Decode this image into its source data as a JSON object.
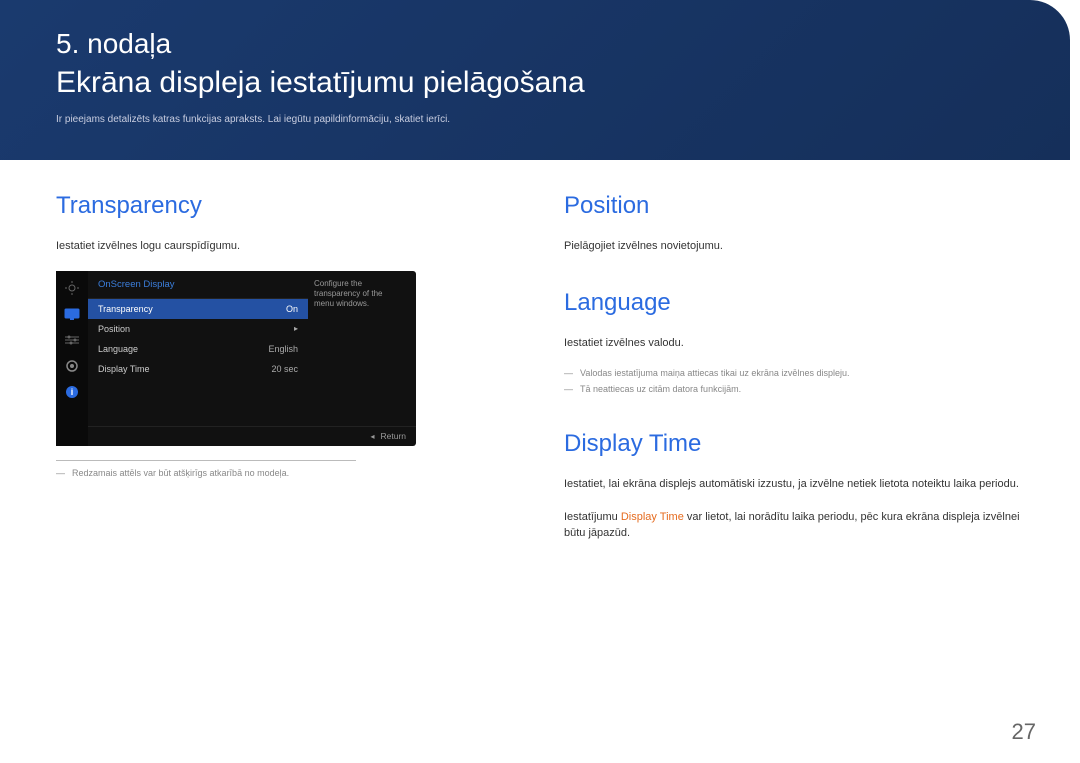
{
  "header": {
    "chapter": "5. nodaļa",
    "title": "Ekrāna displeja iestatījumu pielāgošana",
    "desc": "Ir pieejams detalizēts katras funkcijas apraksts. Lai iegūtu papildinformāciju, skatiet ierīci."
  },
  "left": {
    "transparency": {
      "title": "Transparency",
      "desc": "Iestatiet izvēlnes logu caurspīdīgumu."
    },
    "osd": {
      "title": "OnScreen Display",
      "rows": [
        {
          "label": "Transparency",
          "value": "On",
          "selected": true,
          "caret": false
        },
        {
          "label": "Position",
          "value": "",
          "selected": false,
          "caret": true
        },
        {
          "label": "Language",
          "value": "English",
          "selected": false,
          "caret": false
        },
        {
          "label": "Display Time",
          "value": "20 sec",
          "selected": false,
          "caret": false
        }
      ],
      "side_desc": "Configure the transparency of the menu windows.",
      "return": "Return"
    },
    "footnote": "Redzamais attēls var būt atšķirīgs atkarībā no modeļa."
  },
  "right": {
    "position": {
      "title": "Position",
      "desc": "Pielāgojiet izvēlnes novietojumu."
    },
    "language": {
      "title": "Language",
      "desc": "Iestatiet izvēlnes valodu.",
      "note1": "Valodas iestatījuma maiņa attiecas tikai uz ekrāna izvēlnes displeju.",
      "note2": "Tā neattiecas uz citām datora funkcijām."
    },
    "displayTime": {
      "title": "Display Time",
      "desc1": "Iestatiet, lai ekrāna displejs automātiski izzustu, ja izvēlne netiek lietota noteiktu laika periodu.",
      "desc2a": "Iestatījumu ",
      "desc2highlight": "Display Time",
      "desc2b": " var lietot, lai norādītu laika periodu, pēc kura ekrāna displeja izvēlnei būtu jāpazūd."
    }
  },
  "pageNumber": "27"
}
